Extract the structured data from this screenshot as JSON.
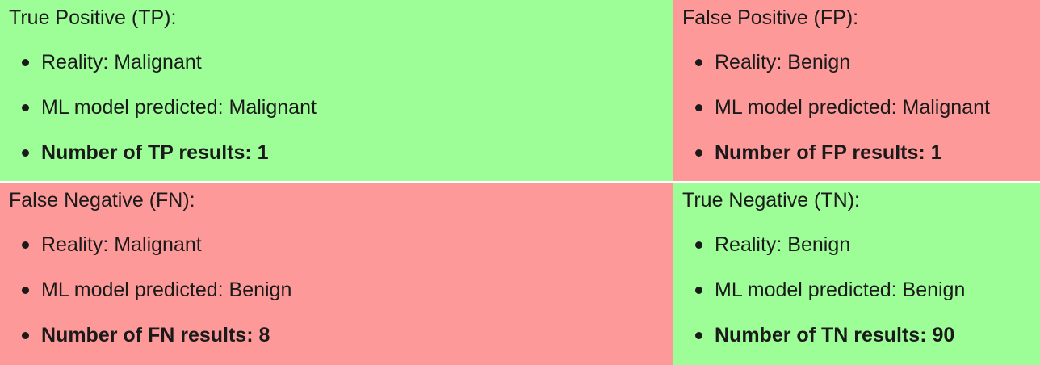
{
  "colors": {
    "correct": "#9dfe98",
    "incorrect": "#fe9999"
  },
  "cells": {
    "tp": {
      "title": "True Positive (TP):",
      "reality": "Reality: Malignant",
      "predicted": "ML model predicted: Malignant",
      "count": "Number of TP results: 1"
    },
    "fp": {
      "title": "False Positive (FP):",
      "reality": "Reality: Benign",
      "predicted": "ML model predicted: Malignant",
      "count": "Number of FP results: 1"
    },
    "fn": {
      "title": "False Negative (FN):",
      "reality": "Reality: Malignant",
      "predicted": "ML model predicted: Benign",
      "count": "Number of FN results: 8"
    },
    "tn": {
      "title": "True Negative (TN):",
      "reality": "Reality: Benign",
      "predicted": "ML model predicted: Benign",
      "count": "Number of TN results: 90"
    }
  }
}
